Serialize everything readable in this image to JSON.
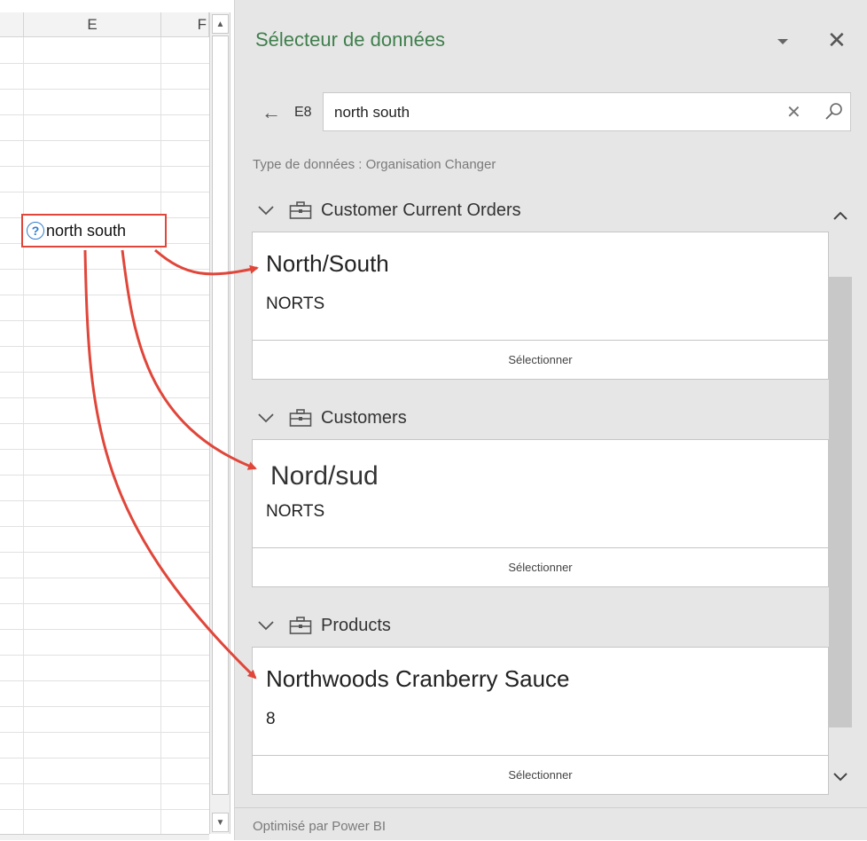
{
  "sheet": {
    "columns": [
      "E",
      "F"
    ],
    "cell_value": "north south"
  },
  "pane": {
    "title": "Sélecteur de données",
    "cell_ref": "E8",
    "search_value": "north south",
    "type_info": "Type de données : Organisation Changer",
    "groups": [
      {
        "name": "Customer Current Orders",
        "title": "North/South",
        "subtitle": "NORTS",
        "action": "Sélectionner"
      },
      {
        "name": "Customers",
        "title": "Nord/sud",
        "subtitle": "NORTS",
        "action": "Sélectionner"
      },
      {
        "name": "Products",
        "title": "Northwoods Cranberry Sauce",
        "subtitle": "8",
        "action": "Sélectionner"
      }
    ],
    "footer": "Optimisé par Power BI"
  },
  "colors": {
    "title_green": "#3f7f4d",
    "annotation_red": "#e0463a",
    "unknown_icon_blue": "#2f7dd1"
  },
  "icons": [
    "question-circle-icon",
    "back-arrow-icon",
    "clear-icon",
    "search-icon",
    "chevron-down-icon",
    "briefcase-icon",
    "close-icon",
    "dropdown-icon",
    "scroll-up-icon",
    "scroll-down-icon"
  ]
}
